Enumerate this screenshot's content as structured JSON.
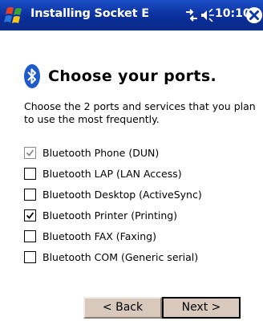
{
  "title_bar": {
    "title": "Installing Socket E",
    "time": "10:10",
    "colors": {
      "background": "#0b3aa8",
      "text": "#ffffff"
    },
    "icons": [
      "windows-start-icon",
      "connectivity-icon",
      "volume-icon",
      "close-icon"
    ]
  },
  "page": {
    "heading": "Choose your ports.",
    "header_icon": "bluetooth-icon",
    "description": "Choose the 2 ports and services that you plan to use the most frequently."
  },
  "options": [
    {
      "label": "Bluetooth Phone (DUN)",
      "checked": true,
      "disabled": true
    },
    {
      "label": "Bluetooth LAP (LAN Access)",
      "checked": false,
      "disabled": false
    },
    {
      "label": "Bluetooth Desktop (ActiveSync)",
      "checked": false,
      "disabled": false
    },
    {
      "label": "Bluetooth Printer (Printing)",
      "checked": true,
      "disabled": false
    },
    {
      "label": "Bluetooth FAX (Faxing)",
      "checked": false,
      "disabled": false
    },
    {
      "label": "Bluetooth COM (Generic serial)",
      "checked": false,
      "disabled": false
    }
  ],
  "buttons": {
    "back": "< Back",
    "next": "Next >"
  }
}
